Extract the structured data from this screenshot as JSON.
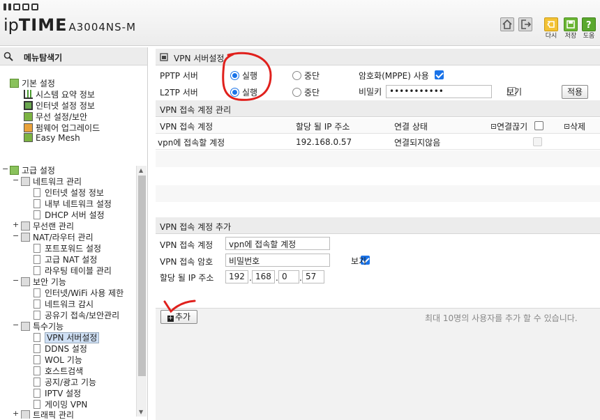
{
  "header": {
    "logo_ip": "ip",
    "logo_time": "TIME",
    "model": "A3004NS-M",
    "buttons": [
      {
        "label": "다시",
        "icon": "back-icon"
      },
      {
        "label": "저장",
        "icon": "save-icon"
      },
      {
        "label": "도움",
        "icon": "help-icon"
      }
    ]
  },
  "sidebar": {
    "title": "메뉴탐색기",
    "basic": {
      "label": "기본 설정",
      "items": [
        "시스템 요약 정보",
        "인터넷 설정 정보",
        "무선 설정/보안",
        "펌웨어 업그레이드",
        "Easy Mesh"
      ]
    },
    "advanced": {
      "label": "고급 설정",
      "groups": [
        {
          "label": "네트워크 관리",
          "items": [
            "인터넷 설정 정보",
            "내부 네트워크 설정",
            "DHCP 서버 설정"
          ]
        },
        {
          "label": "무선랜 관리",
          "items": []
        },
        {
          "label": "NAT/라우터 관리",
          "items": [
            "포트포워드 설정",
            "고급 NAT 설정",
            "라우팅 테이블 관리"
          ]
        },
        {
          "label": "보안 기능",
          "items": [
            "인터넷/WiFi 사용 제한",
            "네트워크 감시",
            "공유기 접속/보안관리"
          ]
        },
        {
          "label": "특수기능",
          "items": [
            "VPN 서버설정",
            "DDNS 설정",
            "WOL 기능",
            "호스트검색",
            "공지/광고 기능",
            "IPTV 설정",
            "게이밍 VPN"
          ]
        },
        {
          "label": "트래픽 관리",
          "items": []
        }
      ]
    }
  },
  "vpn": {
    "title": "VPN 서버설정",
    "pptp": {
      "label": "PPTP 서버",
      "run": "실행",
      "stop": "중단",
      "selected": "실행"
    },
    "l2tp": {
      "label": "L2TP 서버",
      "run": "실행",
      "stop": "중단",
      "selected": "실행"
    },
    "encryption": {
      "label": "암호화(MPPE) 사용",
      "checked": true
    },
    "secret": {
      "label": "비밀키",
      "value": "•••••••••••",
      "show_label": "보기",
      "show_checked": false
    },
    "apply": "적용"
  },
  "accounts": {
    "title": "VPN 접속 계정 관리",
    "columns": [
      "VPN 접속 계정",
      "할당 될 IP 주소",
      "연결 상태",
      "연결끊기",
      "삭제"
    ],
    "rows": [
      {
        "account": "vpn에 접속할 계정",
        "ip": "192.168.0.57",
        "status": "연결되지않음"
      }
    ]
  },
  "add": {
    "title": "VPN 접속 계정 추가",
    "account_label": "VPN 접속 계정",
    "account_value": "vpn에 접속할 계정",
    "password_label": "VPN 접속 암호",
    "password_value": "비밀번호",
    "show_label": "보기",
    "show_checked": true,
    "ip_label": "할당 될 IP 주소",
    "ip": [
      "192",
      "168",
      "0",
      "57"
    ],
    "add_button": "추가",
    "note": "최대 10명의 사용자를 추가 할 수 있습니다."
  },
  "colors": {
    "accent": "#1a73e8",
    "annotation": "#e0201c"
  }
}
